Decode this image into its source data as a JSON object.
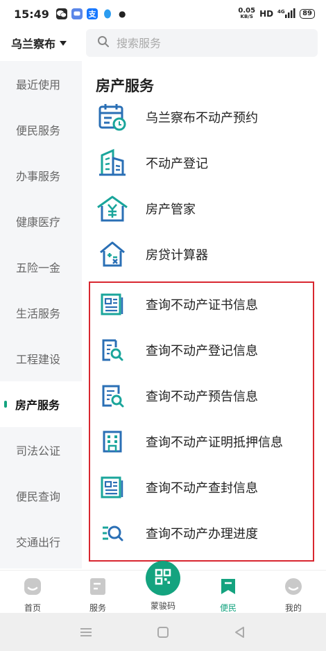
{
  "status_bar": {
    "time": "15:49",
    "apps": [
      {
        "name": "wechat-icon",
        "color": "#2b2b2b",
        "text": ""
      },
      {
        "name": "message-icon",
        "color": "#5a86e8",
        "text": ""
      },
      {
        "name": "alipay-icon",
        "color": "#1677ff",
        "text": "支"
      },
      {
        "name": "qq-icon",
        "color": "#2b9cf0",
        "text": ""
      }
    ],
    "net_speed": "0.05",
    "net_unit": "KB/S",
    "hd": "HD",
    "signal": "⁴ᴳ",
    "battery": "89"
  },
  "header": {
    "city": "乌兰察布",
    "search_placeholder": "搜索服务"
  },
  "sidebar": {
    "items": [
      {
        "label": "最近使用",
        "active": false
      },
      {
        "label": "便民服务",
        "active": false
      },
      {
        "label": "办事服务",
        "active": false
      },
      {
        "label": "健康医疗",
        "active": false
      },
      {
        "label": "五险一金",
        "active": false
      },
      {
        "label": "生活服务",
        "active": false
      },
      {
        "label": "工程建设",
        "active": false
      },
      {
        "label": "房产服务",
        "active": true
      },
      {
        "label": "司法公证",
        "active": false
      },
      {
        "label": "便民查询",
        "active": false
      },
      {
        "label": "交通出行",
        "active": false
      }
    ]
  },
  "main": {
    "section_title": "房产服务",
    "services": [
      {
        "label": "乌兰察布不动产预约",
        "icon": "calendar-clock-icon"
      },
      {
        "label": "不动产登记",
        "icon": "building-icon"
      },
      {
        "label": "房产管家",
        "icon": "house-yen-icon"
      },
      {
        "label": "房贷计算器",
        "icon": "house-calculator-icon"
      },
      {
        "label": "查询不动产证书信息",
        "icon": "certificate-icon"
      },
      {
        "label": "查询不动产登记信息",
        "icon": "document-search-icon"
      },
      {
        "label": "查询不动产预告信息",
        "icon": "document-search-icon"
      },
      {
        "label": "查询不动产证明抵押信息",
        "icon": "office-building-icon"
      },
      {
        "label": "查询不动产查封信息",
        "icon": "certificate-icon"
      },
      {
        "label": "查询不动产办理进度",
        "icon": "list-search-icon"
      }
    ]
  },
  "bottom_nav": {
    "items": [
      {
        "label": "首页",
        "icon": "home-icon",
        "active": false
      },
      {
        "label": "服务",
        "icon": "services-icon",
        "active": false
      },
      {
        "label": "蒙骏码",
        "icon": "qr-code-icon",
        "active": false
      },
      {
        "label": "便民",
        "icon": "bookmark-icon",
        "active": true
      },
      {
        "label": "我的",
        "icon": "profile-icon",
        "active": false
      }
    ]
  },
  "colors": {
    "accent": "#14a37f",
    "icon_teal": "#1aa59b",
    "icon_blue": "#2a6fb5",
    "highlight": "#d8262f"
  }
}
